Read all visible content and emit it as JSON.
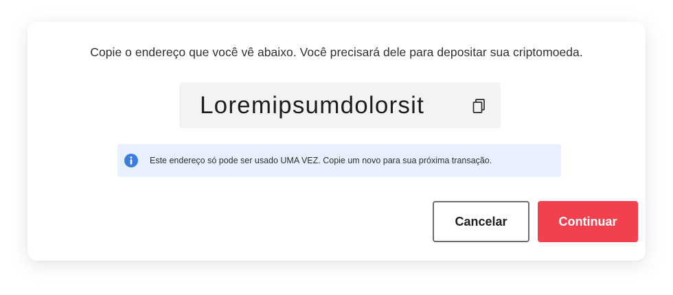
{
  "dialog": {
    "instruction": "Copie o endereço que você vê abaixo. Você precisará dele para depositar sua criptomoeda.",
    "address": {
      "value": "Loremipsumdolorsit",
      "copy_icon": "copy-icon"
    },
    "notice": {
      "icon": "info-icon",
      "text": "Este endereço só pode ser usado UMA VEZ. Copie um novo para sua próxima transação."
    },
    "buttons": {
      "cancel_label": "Cancelar",
      "continue_label": "Continuar"
    }
  },
  "colors": {
    "accent": "#f2404f",
    "info": "#3b7ddd",
    "notice_bg": "#e8f0fd",
    "address_bg": "#f2f3f5"
  }
}
